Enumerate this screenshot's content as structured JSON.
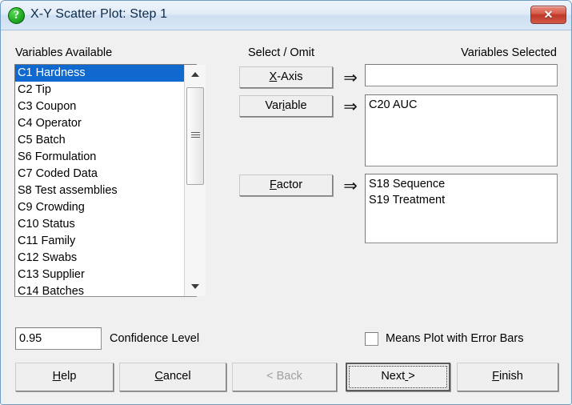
{
  "window": {
    "title": "X-Y Scatter Plot: Step 1",
    "icon": "question-mark-icon",
    "close_label": "✕"
  },
  "available": {
    "label": "Variables Available",
    "items": [
      {
        "text": "C1 Hardness",
        "selected": true
      },
      {
        "text": "C2 Tip",
        "selected": false
      },
      {
        "text": "C3 Coupon",
        "selected": false
      },
      {
        "text": "C4 Operator",
        "selected": false
      },
      {
        "text": "C5 Batch",
        "selected": false
      },
      {
        "text": "S6 Formulation",
        "selected": false
      },
      {
        "text": "C7 Coded Data",
        "selected": false
      },
      {
        "text": "S8 Test assemblies",
        "selected": false
      },
      {
        "text": "C9 Crowding",
        "selected": false
      },
      {
        "text": "C10 Status",
        "selected": false
      },
      {
        "text": "C11 Family",
        "selected": false
      },
      {
        "text": "C12 Swabs",
        "selected": false
      },
      {
        "text": "C13 Supplier",
        "selected": false
      },
      {
        "text": "C14 Batches",
        "selected": false
      }
    ],
    "scroll_up_icon": "scroll-up-arrow-icon",
    "scroll_down_icon": "scroll-down-arrow-icon"
  },
  "select_omit": {
    "label": "Select / Omit",
    "buttons": [
      {
        "label": "X-Axis",
        "accel": "X",
        "accel_index": 0
      },
      {
        "label": "Variable",
        "accel": "i",
        "accel_index": 3
      },
      {
        "label": "Factor",
        "accel": "F",
        "accel_index": 0
      }
    ],
    "arrow_glyph": "⇒"
  },
  "selected": {
    "label": "Variables Selected",
    "x_axis_items": [],
    "variable_items": [
      "C20 AUC"
    ],
    "factor_items": [
      "S18 Sequence",
      "S19 Treatment"
    ]
  },
  "confidence": {
    "value": "0.95",
    "label": "Confidence Level"
  },
  "means_plot": {
    "label": "Means Plot with Error Bars",
    "checked": false
  },
  "footer": {
    "help": {
      "label": "Help",
      "accel_index": 0,
      "disabled": false,
      "default": false
    },
    "cancel": {
      "label": "Cancel",
      "accel_index": 0,
      "disabled": false,
      "default": false
    },
    "back": {
      "label": "< Back",
      "accel_index": -1,
      "disabled": true,
      "default": false
    },
    "next": {
      "label": "Next >",
      "accel_index": 4,
      "disabled": false,
      "default": true
    },
    "finish": {
      "label": "Finish",
      "accel_index": 0,
      "disabled": false,
      "default": false
    }
  },
  "colors": {
    "selection_blue": "#1069cf",
    "dialog_bg": "#f0f0f0",
    "title_bar_border": "#6f9dc4",
    "close_red": "#bf3828",
    "icon_green": "#23b024"
  }
}
